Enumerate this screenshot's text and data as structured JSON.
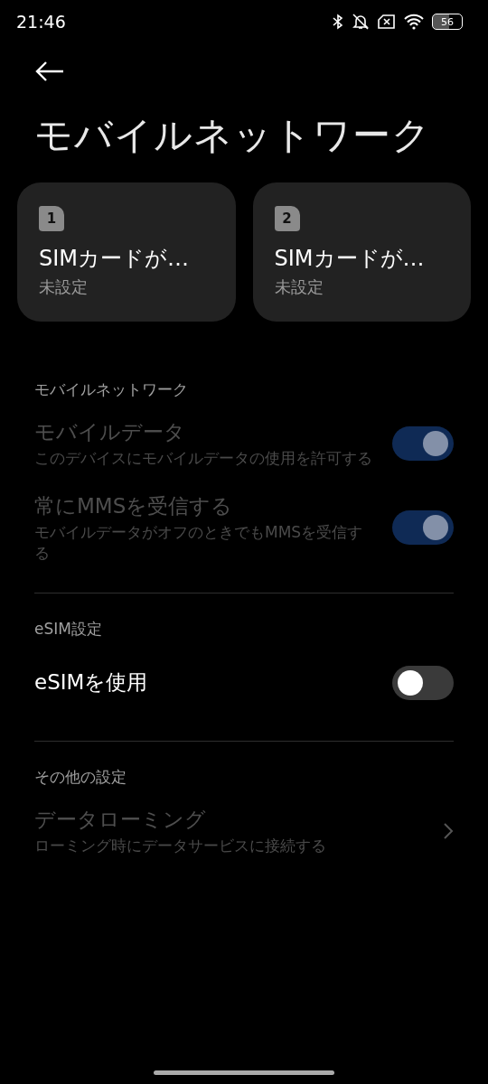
{
  "status_bar": {
    "time": "21:46",
    "battery": "56"
  },
  "title": "モバイルネットワーク",
  "sim_cards": [
    {
      "number": "1",
      "title": "SIMカードが…",
      "subtitle": "未設定"
    },
    {
      "number": "2",
      "title": "SIMカードが…",
      "subtitle": "未設定"
    }
  ],
  "sections": [
    {
      "header": "モバイルネットワーク",
      "items": [
        {
          "kind": "toggle",
          "title": "モバイルデータ",
          "subtitle": "このデバイスにモバイルデータの使用を許可する",
          "on": true,
          "disabled": true
        },
        {
          "kind": "toggle",
          "title": "常にMMSを受信する",
          "subtitle": "モバイルデータがオフのときでもMMSを受信する",
          "on": true,
          "disabled": true
        }
      ]
    },
    {
      "header": "eSIM設定",
      "items": [
        {
          "kind": "toggle",
          "title": "eSIMを使用",
          "on": false,
          "disabled": false
        }
      ]
    },
    {
      "header": "その他の設定",
      "items": [
        {
          "kind": "link",
          "title": "データローミング",
          "subtitle": "ローミング時にデータサービスに接続する",
          "disabled": true
        }
      ]
    }
  ]
}
